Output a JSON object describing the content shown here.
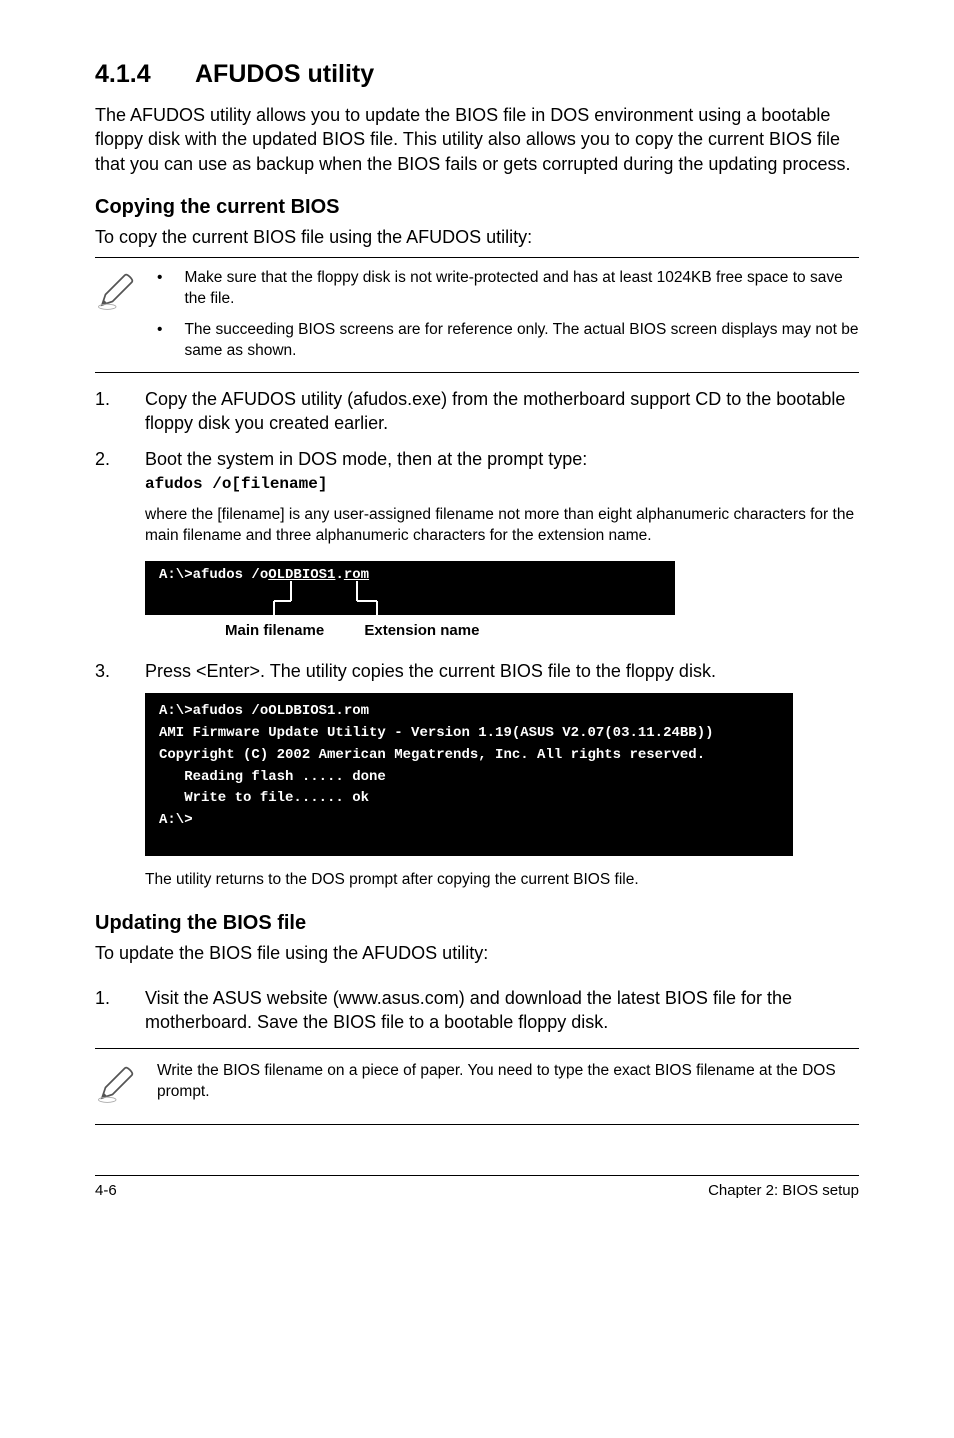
{
  "section": {
    "number": "4.1.4",
    "title": "AFUDOS utility",
    "intro": "The AFUDOS utility allows you to update the BIOS file in DOS environment using a bootable floppy disk with the updated BIOS file. This utility also allows you to copy the current BIOS file that you can use as backup when the BIOS fails or gets corrupted during the updating process."
  },
  "copying": {
    "heading": "Copying the current BIOS",
    "intro": "To copy the current BIOS file using the AFUDOS utility:",
    "note1": "Make sure that the floppy disk is not write-protected and has at least 1024KB free space to save the file.",
    "note2": "The succeeding BIOS screens are for reference only. The actual BIOS screen displays may not be same as shown.",
    "step1": "Copy the AFUDOS utility (afudos.exe) from the motherboard support CD to the bootable floppy disk you created earlier.",
    "step2": "Boot the system in DOS mode, then at the prompt type:",
    "code": "afudos /o[filename]",
    "filename_note": "where the [filename] is any user-assigned filename not more than eight alphanumeric characters  for the main filename and three alphanumeric characters for the extension name.",
    "term1": "A:\\>afudos /oOLDBIOS1.rom",
    "label_main": "Main filename",
    "label_ext": "Extension name",
    "step3": "Press <Enter>. The utility copies the current BIOS file to the floppy disk.",
    "term2_l1": "A:\\>afudos /oOLDBIOS1.rom",
    "term2_l2": "AMI Firmware Update Utility - Version 1.19(ASUS V2.07(03.11.24BB))",
    "term2_l3": "Copyright (C) 2002 American Megatrends, Inc. All rights reserved.",
    "term2_l4": "   Reading flash ..... done",
    "term2_l5": "   Write to file...... ok",
    "term2_l6": "A:\\>",
    "post_term": "The utility returns to the DOS prompt after copying the current BIOS file."
  },
  "updating": {
    "heading": "Updating the BIOS file",
    "intro": "To update the BIOS file using the AFUDOS utility:",
    "step1": "Visit the ASUS website (www.asus.com) and download the latest BIOS file for the motherboard. Save the BIOS file to a bootable floppy disk.",
    "note": "Write the BIOS filename on a piece of paper. You need to type the exact BIOS filename at the DOS prompt."
  },
  "footer": {
    "left": "4-6",
    "right": "Chapter 2: BIOS setup"
  }
}
